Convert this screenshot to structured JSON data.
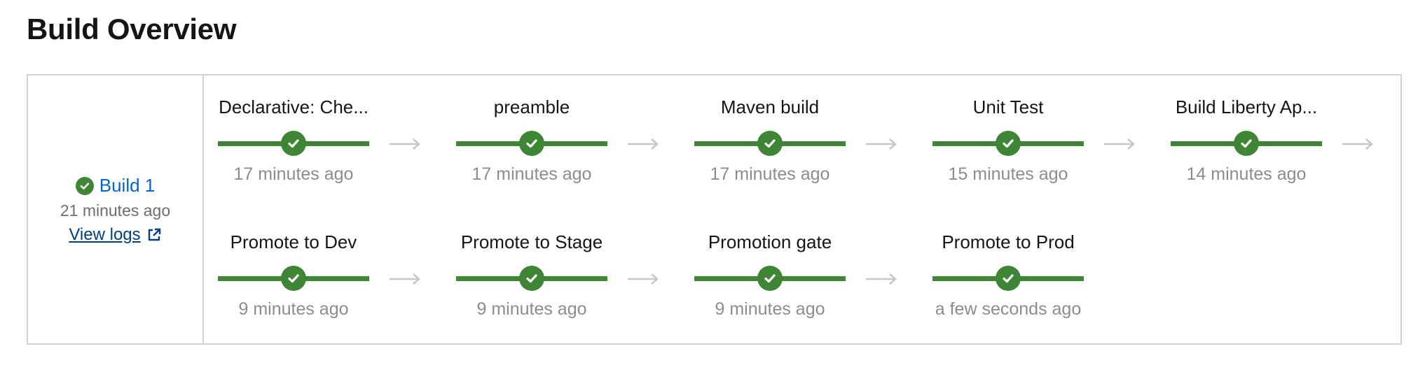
{
  "page": {
    "title": "Build Overview"
  },
  "build": {
    "name": "Build 1",
    "status": "success",
    "time": "21 minutes ago",
    "view_logs_label": "View logs"
  },
  "colors": {
    "success": "#3e8635",
    "link": "#0066cc",
    "muted_text": "#8a8d90",
    "arrow": "#c7c7c7",
    "border": "#d2d2d2"
  },
  "stages": [
    {
      "name": "Declarative: Che...",
      "time": "17 minutes ago",
      "status": "success"
    },
    {
      "name": "preamble",
      "time": "17 minutes ago",
      "status": "success"
    },
    {
      "name": "Maven build",
      "time": "17 minutes ago",
      "status": "success"
    },
    {
      "name": "Unit Test",
      "time": "15 minutes ago",
      "status": "success"
    },
    {
      "name": "Build Liberty Ap...",
      "time": "14 minutes ago",
      "status": "success"
    },
    {
      "name": "Promote to Dev",
      "time": "9 minutes ago",
      "status": "success"
    },
    {
      "name": "Promote to Stage",
      "time": "9 minutes ago",
      "status": "success"
    },
    {
      "name": "Promotion gate",
      "time": "9 minutes ago",
      "status": "success"
    },
    {
      "name": "Promote to Prod",
      "time": "a few seconds ago",
      "status": "success"
    }
  ]
}
